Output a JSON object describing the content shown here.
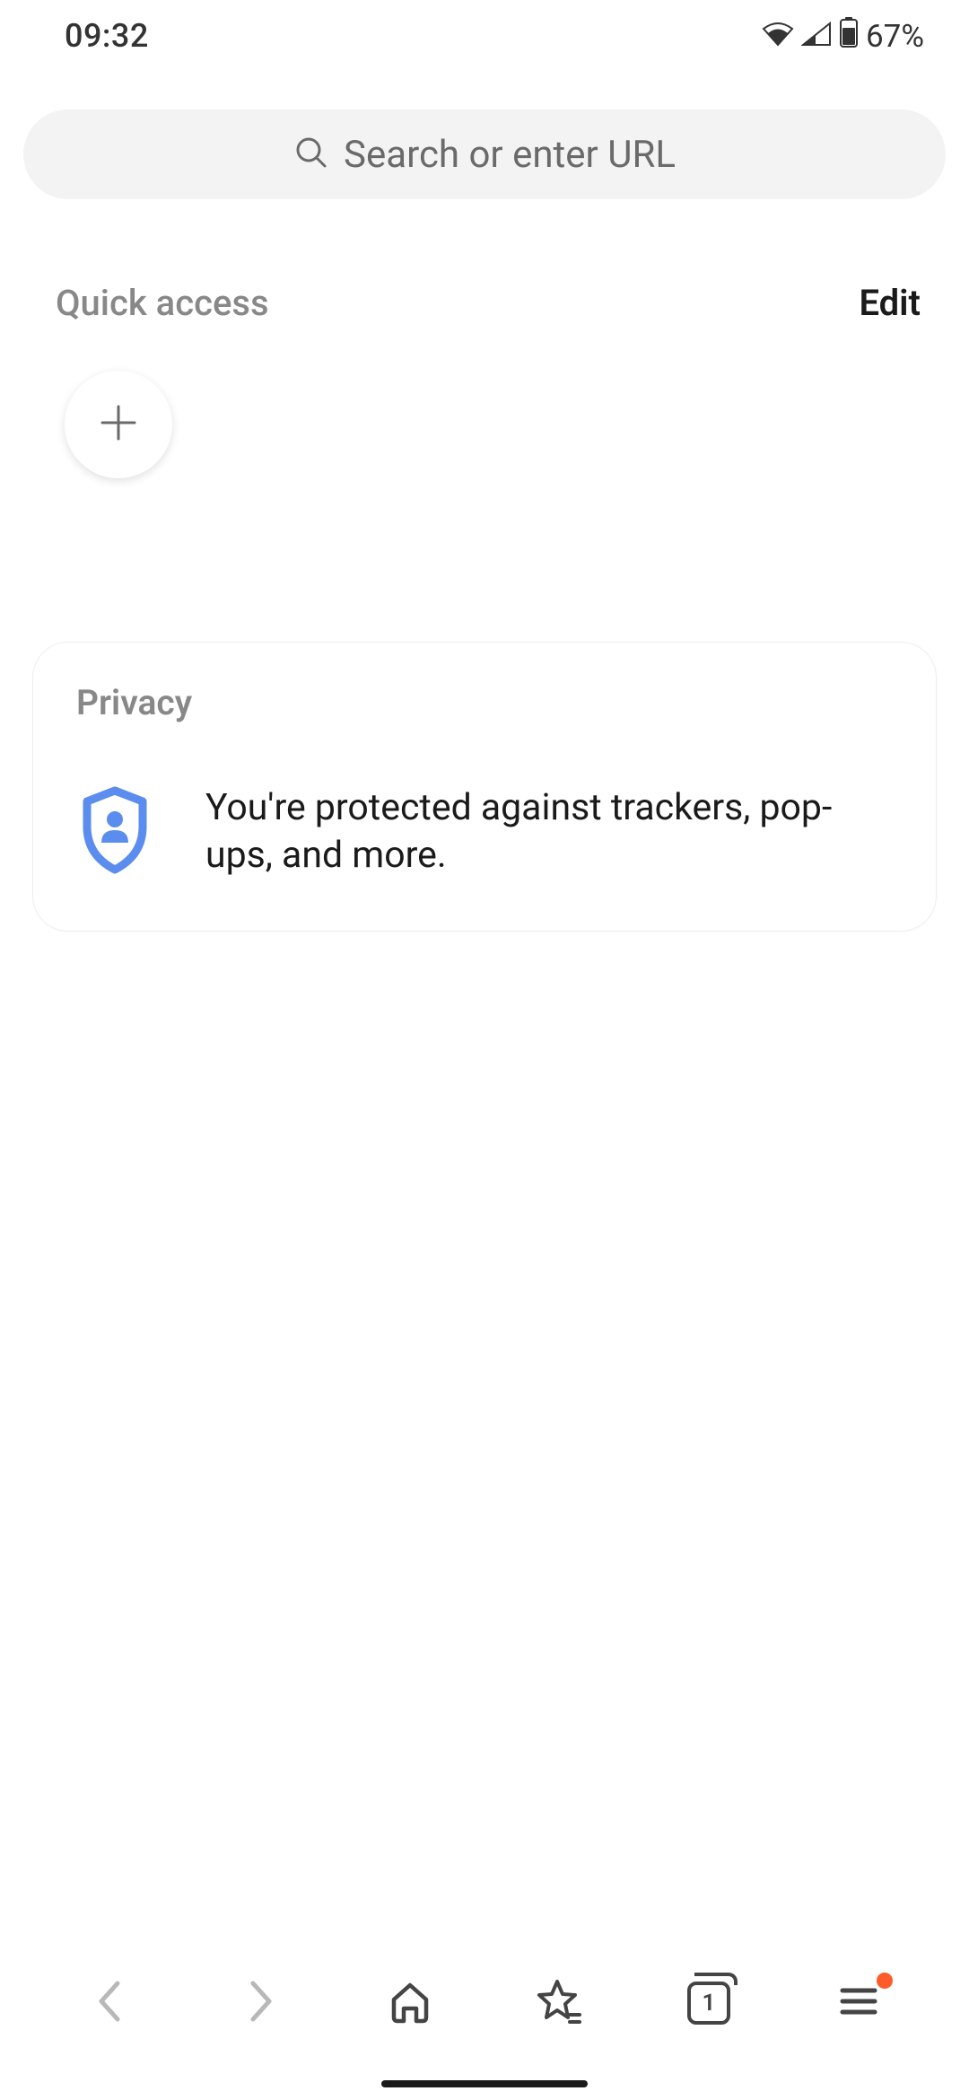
{
  "status": {
    "time": "09:32",
    "battery": "67%"
  },
  "search": {
    "placeholder": "Search or enter URL"
  },
  "quick_access": {
    "title": "Quick access",
    "edit_label": "Edit"
  },
  "privacy": {
    "title": "Privacy",
    "message": "You're protected against trackers, pop-ups, and more."
  },
  "bottom_nav": {
    "tab_count": "1",
    "has_menu_badge": true
  }
}
